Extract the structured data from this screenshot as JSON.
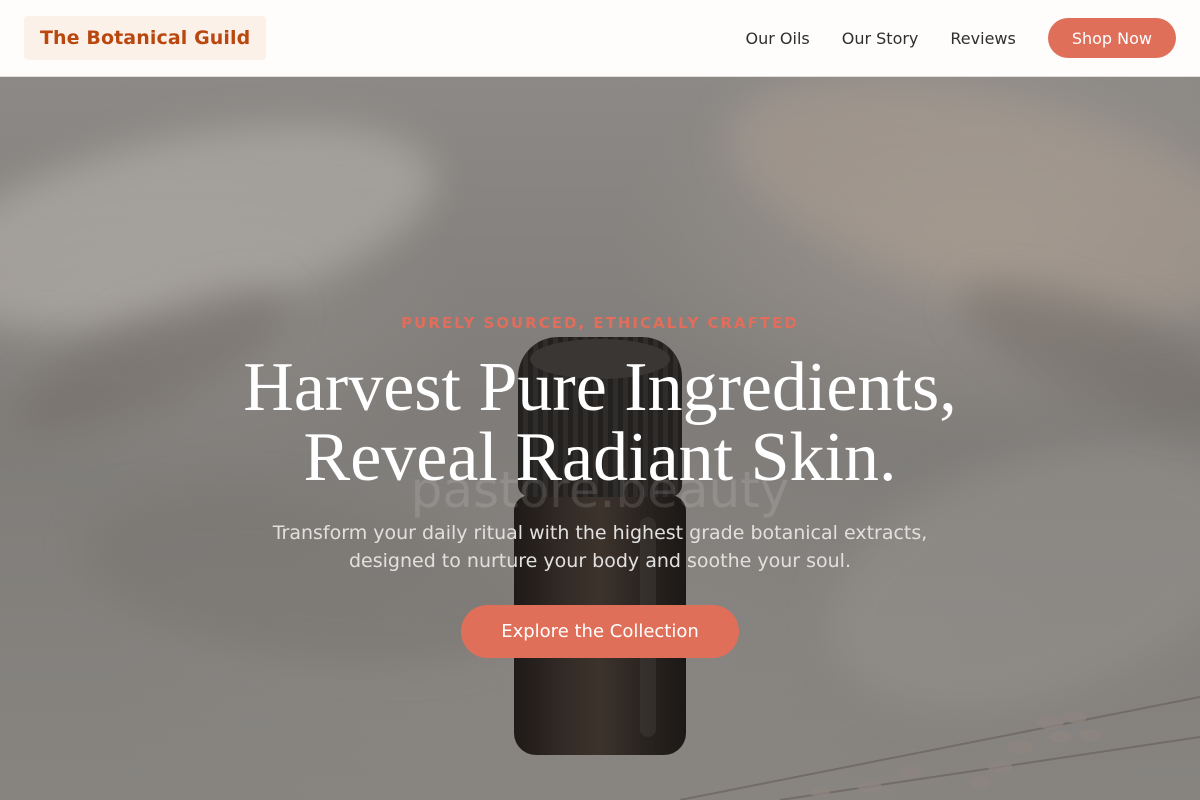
{
  "header": {
    "logo": "The Botanical Guild",
    "nav": [
      {
        "label": "Our Oils"
      },
      {
        "label": "Our Story"
      },
      {
        "label": "Reviews"
      }
    ],
    "shop_label": "Shop Now"
  },
  "hero": {
    "tagline": "PURELY SOURCED, ETHICALLY CRAFTED",
    "headline_line1": "Harvest Pure Ingredients,",
    "headline_line2": "Reveal Radiant Skin.",
    "subtext": "Transform your daily ritual with the highest grade botanical extracts, designed to nurture your body and soothe your soul.",
    "cta_label": "Explore the Collection",
    "watermark": "pastore.beauty"
  },
  "colors": {
    "accent": "#e06f5a",
    "logo_text": "#b9470e",
    "header_bg": "#fefdfc"
  },
  "icons": {
    "bottle": "essential-oil-bottle-illustration",
    "lavender": "lavender-sprig-illustration"
  }
}
